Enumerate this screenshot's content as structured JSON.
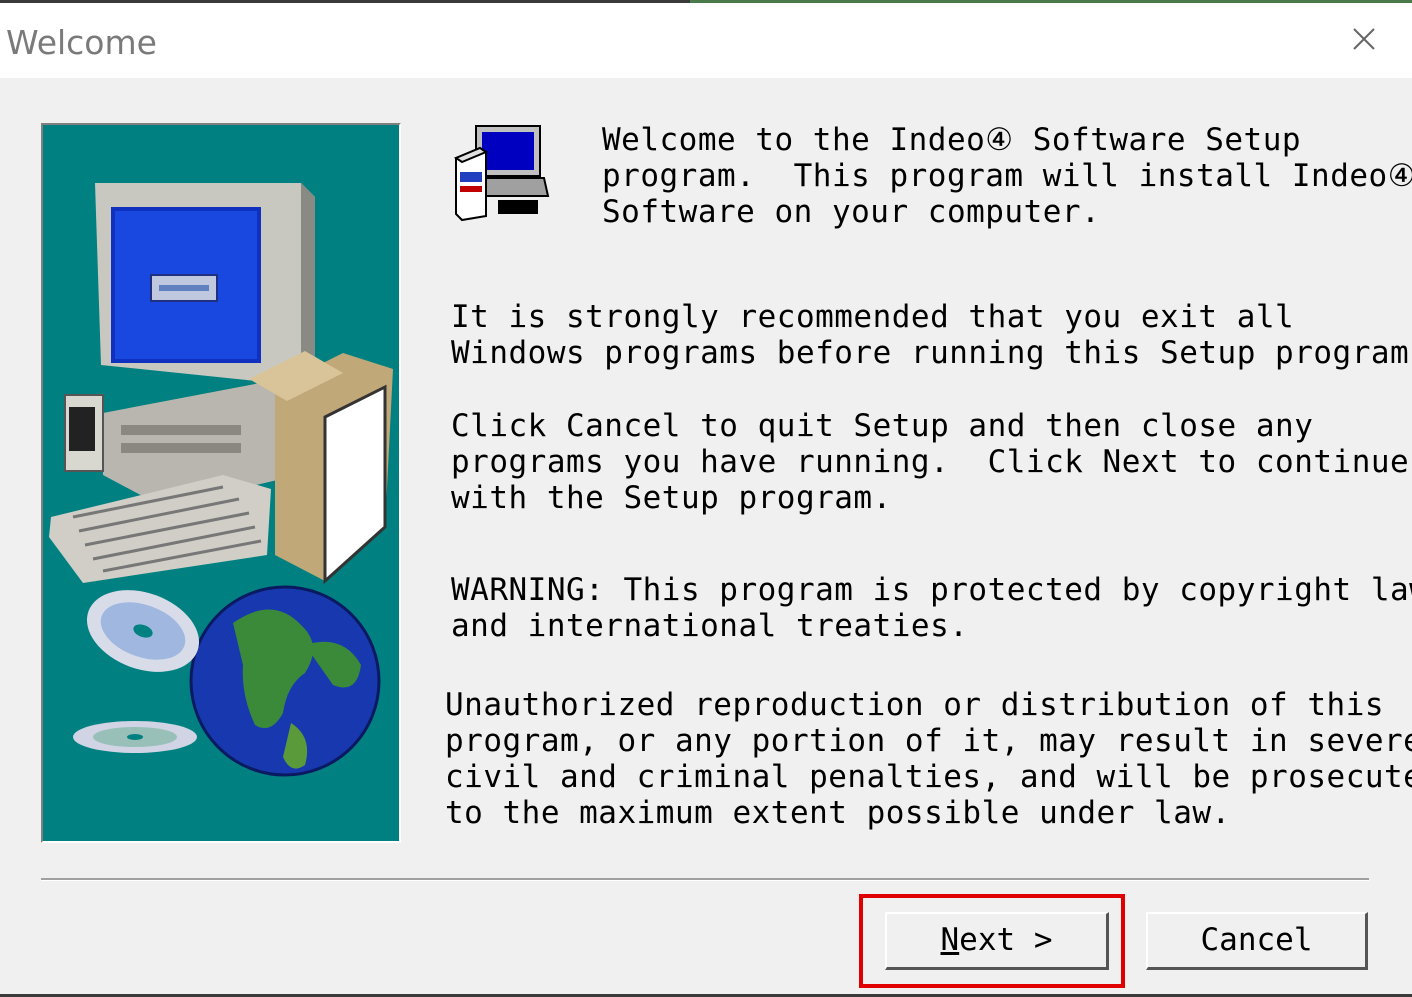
{
  "window": {
    "title": "Welcome"
  },
  "icons": {
    "close": "close-icon",
    "setup": "setup-computer-icon",
    "side_art": "computer-globe-cd-illustration"
  },
  "body": {
    "intro": "Welcome to the Indeo④ Software Setup\nprogram.  This program will install Indeo④\nSoftware on your computer.",
    "recommend": "It is strongly recommended that you exit all\nWindows programs before running this Setup program.",
    "instructions": "Click Cancel to quit Setup and then close any\nprograms you have running.  Click Next to continue\nwith the Setup program.",
    "warning": "WARNING: This program is protected by copyright law\nand international treaties.",
    "legal": "Unauthorized reproduction or distribution of this\nprogram, or any portion of it, may result in severe\ncivil and criminal penalties, and will be prosecuted\nto the maximum extent possible under law."
  },
  "buttons": {
    "next": {
      "mnemonic": "N",
      "rest": "ext >"
    },
    "cancel": "Cancel"
  },
  "colors": {
    "panel_bg": "#008080",
    "highlight": "#e00000",
    "dialog_bg": "#f0f0f0"
  }
}
